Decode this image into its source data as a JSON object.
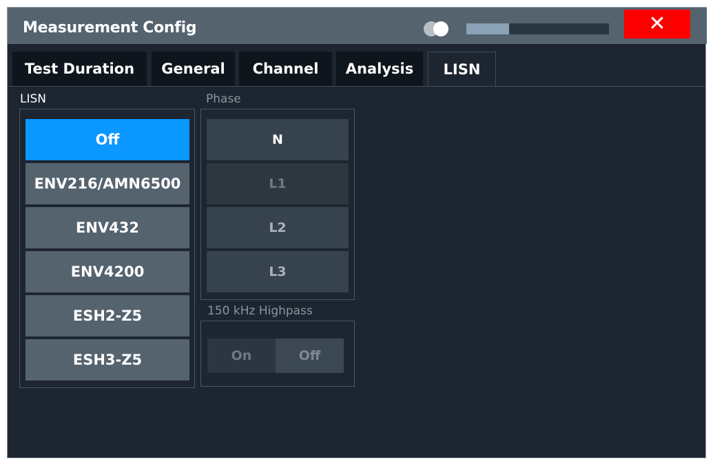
{
  "dialog": {
    "title": "Measurement Config",
    "transparency_level": 0.3,
    "close_label": "✕"
  },
  "tabs": [
    {
      "label": "Test Duration",
      "active": false
    },
    {
      "label": "General",
      "active": false
    },
    {
      "label": "Channel",
      "active": false
    },
    {
      "label": "Analysis",
      "active": false
    },
    {
      "label": "LISN",
      "active": true
    }
  ],
  "lisn": {
    "label": "LISN",
    "options": [
      "Off",
      "ENV216/AMN6500",
      "ENV432",
      "ENV4200",
      "ESH2-Z5",
      "ESH3-Z5"
    ],
    "selected": "Off"
  },
  "phase": {
    "label": "Phase",
    "options": [
      "N",
      "L1",
      "L2",
      "L3"
    ],
    "selected": "N",
    "disabled": [
      "L1"
    ]
  },
  "highpass": {
    "label": "150 kHz Highpass",
    "on_label": "On",
    "off_label": "Off",
    "selected": "Off"
  },
  "colors": {
    "accent": "#0a97ff",
    "close": "#ff0000",
    "background": "#1c2530",
    "titlebar": "#55636f"
  }
}
